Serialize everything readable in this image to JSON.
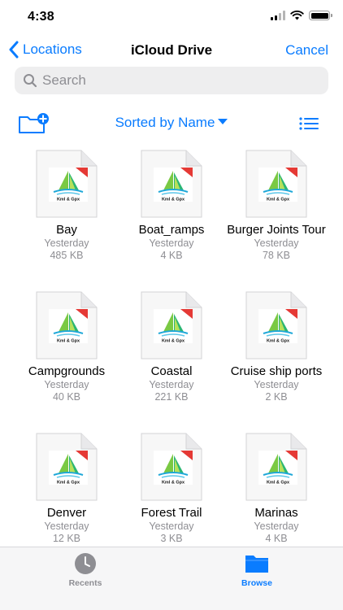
{
  "status": {
    "time": "4:38"
  },
  "nav": {
    "back_label": "Locations",
    "title": "iCloud Drive",
    "cancel_label": "Cancel"
  },
  "search": {
    "placeholder": "Search",
    "value": ""
  },
  "toolbar": {
    "sort_label": "Sorted by Name"
  },
  "files": [
    {
      "name": "Bay",
      "date": "Yesterday",
      "size": "485 KB",
      "badge": "Kml & Gpx"
    },
    {
      "name": "Boat_ramps",
      "date": "Yesterday",
      "size": "4 KB",
      "badge": "Kml & Gpx"
    },
    {
      "name": "Burger Joints Tour",
      "date": "Yesterday",
      "size": "78 KB",
      "badge": "Kml & Gpx"
    },
    {
      "name": "Campgrounds",
      "date": "Yesterday",
      "size": "40 KB",
      "badge": "Kml & Gpx"
    },
    {
      "name": "Coastal",
      "date": "Yesterday",
      "size": "221 KB",
      "badge": "Kml & Gpx"
    },
    {
      "name": "Cruise ship ports",
      "date": "Yesterday",
      "size": "2 KB",
      "badge": "Kml & Gpx"
    },
    {
      "name": "Denver",
      "date": "Yesterday",
      "size": "12 KB",
      "badge": "Kml & Gpx"
    },
    {
      "name": "Forest Trail",
      "date": "Yesterday",
      "size": "3 KB",
      "badge": "Kml & Gpx"
    },
    {
      "name": "Marinas",
      "date": "Yesterday",
      "size": "4 KB",
      "badge": "Kml & Gpx"
    }
  ],
  "tabs": {
    "recents_label": "Recents",
    "browse_label": "Browse"
  },
  "colors": {
    "accent": "#0a7cff",
    "secondary_text": "#8e8e93",
    "ribbon": "#e53935"
  },
  "icons": [
    "chevron-left-icon",
    "search-icon",
    "new-folder-icon",
    "list-view-icon",
    "clock-icon",
    "folder-icon",
    "wifi-icon",
    "battery-icon",
    "signal-icon"
  ]
}
